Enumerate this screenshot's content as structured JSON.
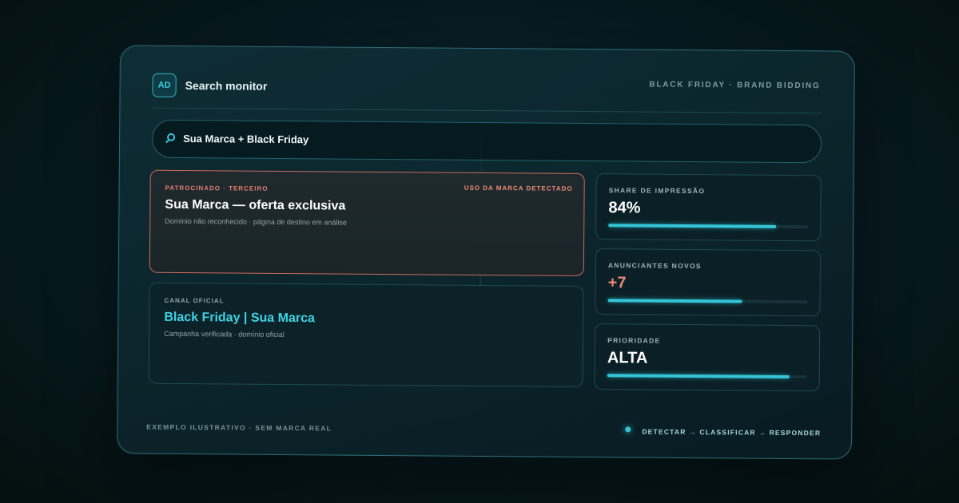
{
  "header": {
    "logo_text": "AD",
    "title": "Search monitor",
    "tag": "BLACK FRIDAY · BRAND BIDDING"
  },
  "search": {
    "query": "Sua Marca + Black Friday",
    "icon": "search-icon"
  },
  "results": [
    {
      "eyebrow": "PATROCINADO · TERCEIRO",
      "tag": "USO DA MARCA DETECTADO",
      "title": "Sua Marca — oferta exclusiva",
      "subtitle": "Domínio não reconhecido · página de destino em análise",
      "status_color": "#e57f6f"
    },
    {
      "eyebrow": "CANAL OFICIAL",
      "title": "Black Friday | Sua Marca",
      "subtitle": "Campanha verificada · domínio oficial",
      "status_color": "#3fd3e3"
    }
  ],
  "metrics": [
    {
      "label": "SHARE DE IMPRESSÃO",
      "value": "84%",
      "level": 0.84
    },
    {
      "label": "ANUNCIANTES NOVOS",
      "value": "+7",
      "level": 0.67
    },
    {
      "label": "PRIORIDADE",
      "value": "ALTA",
      "level": 0.91
    }
  ],
  "footer": {
    "note": "EXEMPLO ILUSTRATIVO · SEM MARCA REAL",
    "pipeline": "DETECTAR → CLASSIFICAR → RESPONDER"
  },
  "colors": {
    "accent": "#33c4d6",
    "alert": "#d06a5e",
    "background": "#071a20"
  }
}
